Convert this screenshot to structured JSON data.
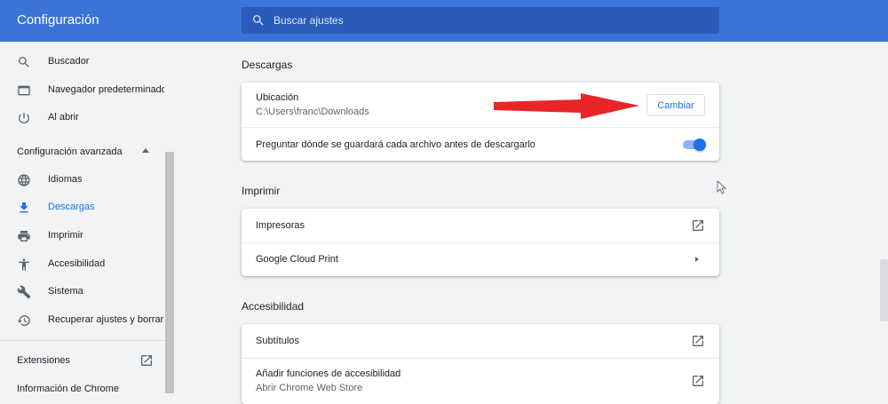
{
  "header": {
    "title": "Configuración",
    "search_placeholder": "Buscar ajustes",
    "color": "#3b74d6"
  },
  "sidebar": {
    "items_top": [
      {
        "label": "Buscador",
        "icon": "search-icon"
      },
      {
        "label": "Navegador predeterminado",
        "icon": "browser-icon"
      },
      {
        "label": "Al abrir",
        "icon": "power-icon"
      }
    ],
    "advanced_label": "Configuración avanzada",
    "items_advanced": [
      {
        "label": "Idiomas",
        "icon": "globe-icon"
      },
      {
        "label": "Descargas",
        "icon": "download-icon",
        "active": true
      },
      {
        "label": "Imprimir",
        "icon": "printer-icon"
      },
      {
        "label": "Accesibilidad",
        "icon": "accessibility-icon"
      },
      {
        "label": "Sistema",
        "icon": "wrench-icon"
      },
      {
        "label": "Recuperar ajustes y borrar",
        "icon": "history-icon"
      }
    ],
    "extensions_label": "Extensiones",
    "about_label": "Información de Chrome"
  },
  "downloads": {
    "title": "Descargas",
    "location_label": "Ubicación",
    "location_value": "C:\\Users\\franc\\Downloads",
    "change_button": "Cambiar",
    "ask_label": "Preguntar dónde se guardará cada archivo antes de descargarlo",
    "ask_enabled": true
  },
  "printing": {
    "title": "Imprimir",
    "printers_label": "Impresoras",
    "cloud_print_label": "Google Cloud Print"
  },
  "accessibility": {
    "title": "Accesibilidad",
    "captions_label": "Subtítulos",
    "add_features_label": "Añadir funciones de accesibilidad",
    "add_features_sub": "Abrir Chrome Web Store"
  },
  "colors": {
    "accent": "#1a73e8",
    "annotation_arrow": "#e8262a"
  }
}
